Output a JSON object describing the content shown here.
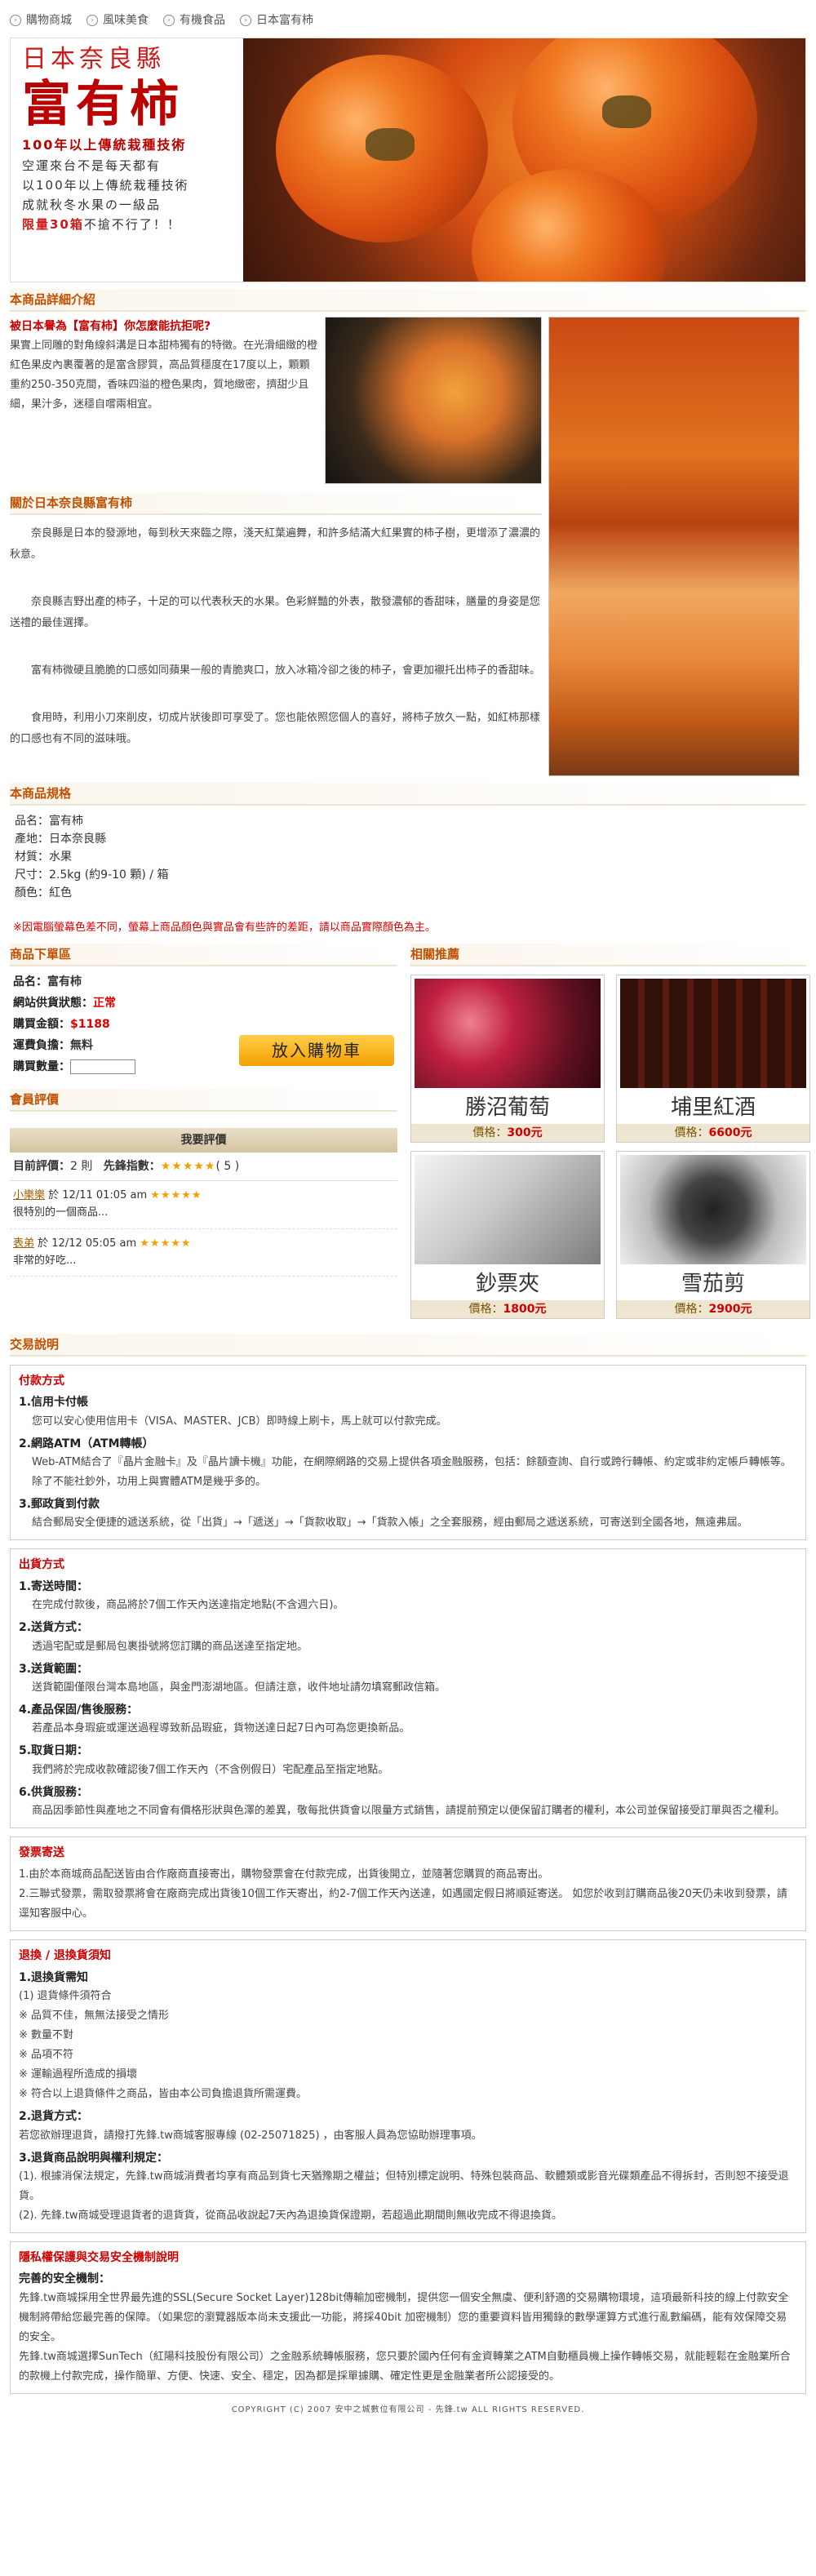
{
  "breadcrumb": [
    "購物商城",
    "風味美食",
    "有機食品",
    "日本富有柿"
  ],
  "hero": {
    "line1": "日本奈良縣",
    "title": "富有柿",
    "tagline": "100年以上傳統栽種技術",
    "p1": "空運來台不是每天都有",
    "p2": "以100年以上傳統栽種技術",
    "p3": "成就秋冬水果の一級品",
    "p4_red": "限量30箱",
    "p4": "不搶不行了！！"
  },
  "sections": {
    "details": "本商品詳細介紹",
    "about": "關於日本奈良縣富有柿",
    "specs": "本商品規格",
    "order": "商品下單區",
    "related": "相關推薦",
    "reviews": "會員評價",
    "transaction": "交易說明"
  },
  "intro": {
    "q": "被日本譽為【富有柿】你怎麼能抗拒呢?",
    "t1": "果實上同雕的對角線斜溝是日本甜柿獨有的特徵。在光滑細緻的橙紅色果皮內裹覆著的是富含膠質，高品質穩度在17度以上，顆顆重約250-350克間，香味四溢的橙色果肉，質地緻密，擠甜少且細，果汁多，迷穩自嚐兩相宜。"
  },
  "about": {
    "p1": "奈良縣是日本的發源地，每到秋天來臨之際，淺天紅葉遍舞，和許多結滿大紅果實的柿子樹，更增添了濃濃的秋意。",
    "p2": "奈良縣吉野出產的柿子，十足的可以代表秋天的水果。色彩鮮豔的外表，散發濃郁的香甜味，膳量的身姿是您送禮的最佳選擇。",
    "p3": "富有柿微硬且脆脆的口感如同蘋果一般的青脆爽口，放入冰箱冷卻之後的柿子，會更加襯托出柿子的香甜味。",
    "p4": "食用時，利用小刀來削皮，切成片狀後即可享受了。您也能依照您個人的喜好，將柿子放久一點，如紅柿那樣的口感也有不同的滋味哦。"
  },
  "specs": [
    "品名：富有柿",
    "產地：日本奈良縣",
    "材質：水果",
    "尺寸：2.5kg (約9-10 顆) / 箱",
    "顏色：紅色"
  ],
  "notice": "※因電腦螢幕色差不同，螢幕上商品顏色與實品會有些許的差距，請以商品實際顏色為主。",
  "order": {
    "name_label": "品名：",
    "name": "富有柿",
    "status_label": "網站供貨狀態：",
    "status": "正常",
    "price_label": "購買金額：",
    "price": "$1188",
    "ship_label": "運費負擔：",
    "ship": "無料",
    "qty_label": "購買數量：",
    "cart": "放入購物車"
  },
  "reviews": {
    "write": "我要評價",
    "count_label": "目前評價：",
    "count": "2 則",
    "index_label": "先鋒指數：",
    "stars": "★★★★★",
    "score": "( 5 )",
    "items": [
      {
        "user": "小樂樂",
        "time": "於 12/11 01:05 am",
        "stars": "★★★★★",
        "text": "很特別的一個商品..."
      },
      {
        "user": "表弟",
        "time": "於 12/12 05:05 am",
        "stars": "★★★★★",
        "text": "非常的好吃..."
      }
    ]
  },
  "related": [
    {
      "name": "勝沼葡萄",
      "price_label": "價格：",
      "price": "300元"
    },
    {
      "name": "埔里紅酒",
      "price_label": "價格：",
      "price": "6600元"
    },
    {
      "name": "鈔票夾",
      "price_label": "價格：",
      "price": "1800元"
    },
    {
      "name": "雪茄剪",
      "price_label": "價格：",
      "price": "2900元"
    }
  ],
  "pay": {
    "title": "付款方式",
    "h1": "1.信用卡付帳",
    "d1": "您可以安心使用信用卡（VISA、MASTER、JCB）即時線上刷卡，馬上就可以付款完成。",
    "h2": "2.網路ATM（ATM轉帳）",
    "d2": "Web-ATM結合了『晶片金融卡』及『晶片讀卡機』功能，在網際網路的交易上提供各項金融服務，包括：餘額查詢、自行或跨行轉帳、約定或非約定帳戶轉帳等。除了不能社鈔外，功用上與實體ATM是幾乎多的。",
    "h3": "3.郵政貨到付款",
    "d3": "結合郵局安全便捷的遞送系統，從「出貨」→「遞送」→「貨款收取」→「貨款入帳」之全套服務，經由郵局之遞送系統，可寄送到全國各地，無遠弗屆。"
  },
  "ship": {
    "title": "出貨方式",
    "h1": "1.寄送時間：",
    "d1": "在完成付款後，商品將於7個工作天內送達指定地點(不含週六日)。",
    "h2": "2.送貨方式：",
    "d2": "透過宅配或是郵局包裹掛號將您訂購的商品送達至指定地。",
    "h3": "3.送貨範圍：",
    "d3": "送貨範圍僅限台灣本島地區，與金門澎湖地區。但請注意，收件地址請勿填寫郵政信箱。",
    "h4": "4.產品保固/售後服務：",
    "d4": "若產品本身瑕疵或運送過程導致新品瑕疵，貨物送達日起7日內可為您更換新品。",
    "h5": "5.取貨日期：",
    "d5": "我們將於完成收款確認後7個工作天內（不含例假日）宅配產品至指定地點。",
    "h6": "6.供貨服務：",
    "d6": "商品因季節性與產地之不同會有價格形狀與色澤的差異，敬每批供貨會以限量方式銷售，請提前預定以便保留訂購者的權利，本公司並保留接受訂單與否之權利。"
  },
  "invoice": {
    "title": "發票寄送",
    "d1": "1.由於本商城商品配送皆由合作廠商直接寄出，購物發票會在付款完成，出貨後開立，並隨著您購買的商品寄出。",
    "d2": "2.三聯式發票，需取發票將會在廠商完成出貨後10個工作天寄出，約2-7個工作天內送達，如遇國定假日將順延寄送。 如您於收到訂購商品後20天仍未收到發票，請逕知客服中心。"
  },
  "ret": {
    "title": "退換 / 退換貨須知",
    "h1": "1.退換貨需知",
    "l1": "(1) 退貨條件須符合",
    "l2": "※ 品質不佳，無無法接受之情形",
    "l3": "※ 數量不對",
    "l4": "※ 品項不符",
    "l5": "※ 運輸過程所造成的損壞",
    "l6": "※ 符合以上退貨條件之商品，皆由本公司負擔退貨所需運費。",
    "h2": "2.退貨方式：",
    "d2": "若您欲辦理退貨，請撥打先鋒.tw商城客服專線 (02-25071825) ，由客服人員為您協助辦理事項。",
    "h3": "3.退貨商品說明與權利規定：",
    "d3a": "(1). 根據消保法規定，先鋒.tw商城消費者均享有商品到貨七天猶豫期之權益；但特別標定說明、特殊包裝商品、軟體類或影音光碟類產品不得拆封，否則恕不接受退貨。",
    "d3b": "(2). 先鋒.tw商城受理退貨者的退貨貨，從商品收說起7天內為退換貨保證期，若超過此期間則無收完成不得退換貨。"
  },
  "privacy": {
    "title": "隱私權保護與交易安全機制說明",
    "h1": "完善的安全機制：",
    "d1": "先鋒.tw商城採用全世界最先進的SSL(Secure Socket Layer)128bit傳輸加密機制，提供您一個安全無虞、便利舒適的交易購物環境，這項最新科技的線上付款安全機制將帶給您最完善的保障。（如果您的瀏覽器版本尚未支援此一功能，將採40bit 加密機制）您的重要資料皆用獨錄的數學運算方式進行亂數編碼，能有效保障交易的安全。",
    "d2": "先鋒.tw商城選擇SunTech（紅陽科技股份有限公司）之金融系統轉帳服務，您只要於國內任何有金資轉業之ATM自動櫃員機上操作轉帳交易，就能輕鬆在金融業所合的款機上付款完成，操作簡單、方便、快速、安全、穩定，因為都是採單據購、確定性更是金融業者所公認接受的。"
  },
  "footer": "COPYRIGHT (C) 2007 安中之城數位有限公司 - 先鋒.tw ALL RIGHTS RESERVED."
}
